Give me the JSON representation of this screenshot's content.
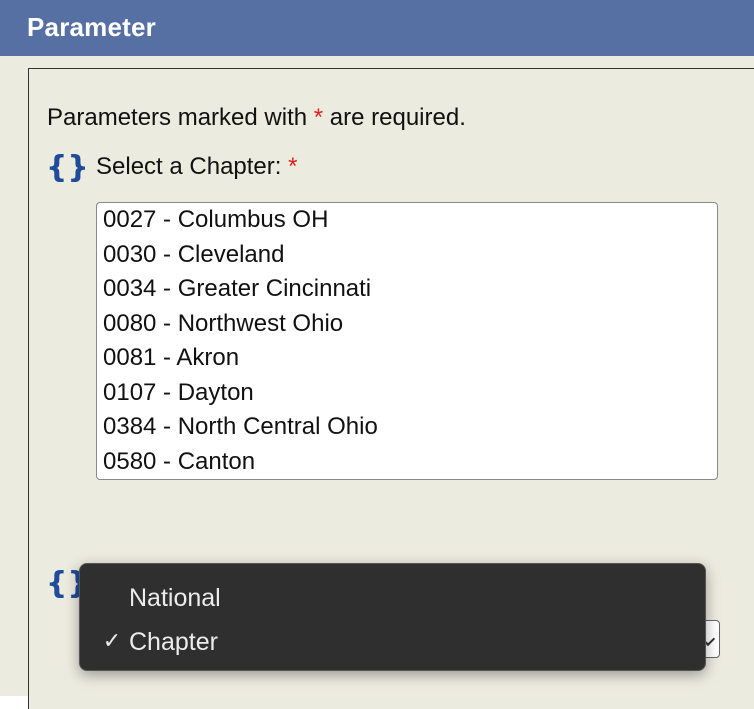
{
  "header": {
    "title": "Parameter"
  },
  "form": {
    "required_note_prefix": "Parameters marked with",
    "required_star": "*",
    "required_note_suffix": "are required.",
    "chapter_label": "Select a Chapter:",
    "chapter_options": [
      "0027 - Columbus OH",
      "0030 - Cleveland",
      "0034 - Greater Cincinnati",
      "0080 - Northwest Ohio",
      "0081 - Akron",
      "0107 - Dayton",
      "0384 - North Central Ohio",
      "0580 - Canton"
    ]
  },
  "level_dropdown": {
    "options": [
      {
        "label": "National",
        "selected": false
      },
      {
        "label": "Chapter",
        "selected": true
      }
    ],
    "check_glyph": "✓"
  },
  "colors": {
    "header_bg": "#5670a3",
    "panel_bg": "#ecebdf",
    "required_star": "#e02020",
    "brace_icon": "#1f4c9a",
    "popup_bg": "#2f2f2f"
  }
}
